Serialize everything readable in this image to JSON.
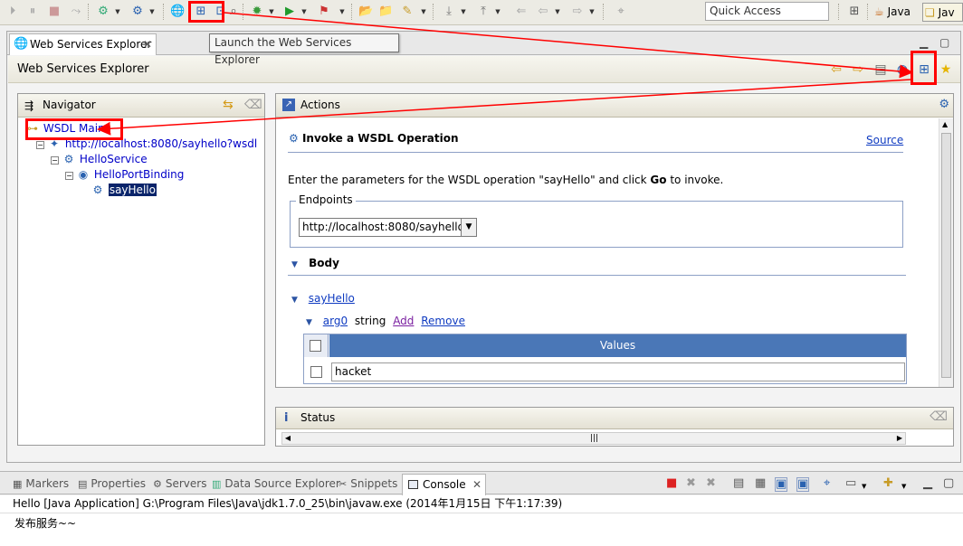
{
  "toolbar": {
    "quick_access_placeholder": "Quick Access",
    "perspective_java": "Java",
    "perspective_javaee": "Jav",
    "tooltip": "Launch the Web Services Explorer"
  },
  "editor": {
    "tab_title": "Web Services Explorer",
    "header_title": "Web Services Explorer"
  },
  "navigator": {
    "title": "Navigator",
    "tree": {
      "root": "WSDL Main",
      "wsdl_url": "http://localhost:8080/sayhello?wsdl",
      "service": "HelloService",
      "binding": "HelloPortBinding",
      "operation": "sayHello"
    }
  },
  "actions": {
    "title": "Actions",
    "invoke_title": "Invoke a WSDL Operation",
    "source_link": "Source",
    "instruction_prefix": "Enter the parameters for the WSDL operation \"sayHello\" and click ",
    "instruction_go": "Go",
    "instruction_suffix": " to invoke.",
    "endpoints_label": "Endpoints",
    "endpoint_value": "http://localhost:8080/sayhello",
    "body_label": "Body",
    "operation_link": "sayHello",
    "arg_name": "arg0",
    "arg_type": "string",
    "add_link": "Add",
    "remove_link": "Remove",
    "values_header": "Values",
    "value_input": "hacket"
  },
  "status": {
    "title": "Status"
  },
  "console": {
    "tabs": [
      "Markers",
      "Properties",
      "Servers",
      "Data Source Explorer",
      "Snippets"
    ],
    "active_tab": "Console",
    "description": "Hello [Java Application] G:\\Program Files\\Java\\jdk1.7.0_25\\bin\\javaw.exe (2014年1月15日 下午1:17:39)",
    "output": "发布服务~~"
  },
  "colors": {
    "annotation_red": "#ff0000",
    "values_header_bg": "#4a77b7",
    "link_blue": "#0f3bc1",
    "selection_bg": "#0a246a"
  }
}
